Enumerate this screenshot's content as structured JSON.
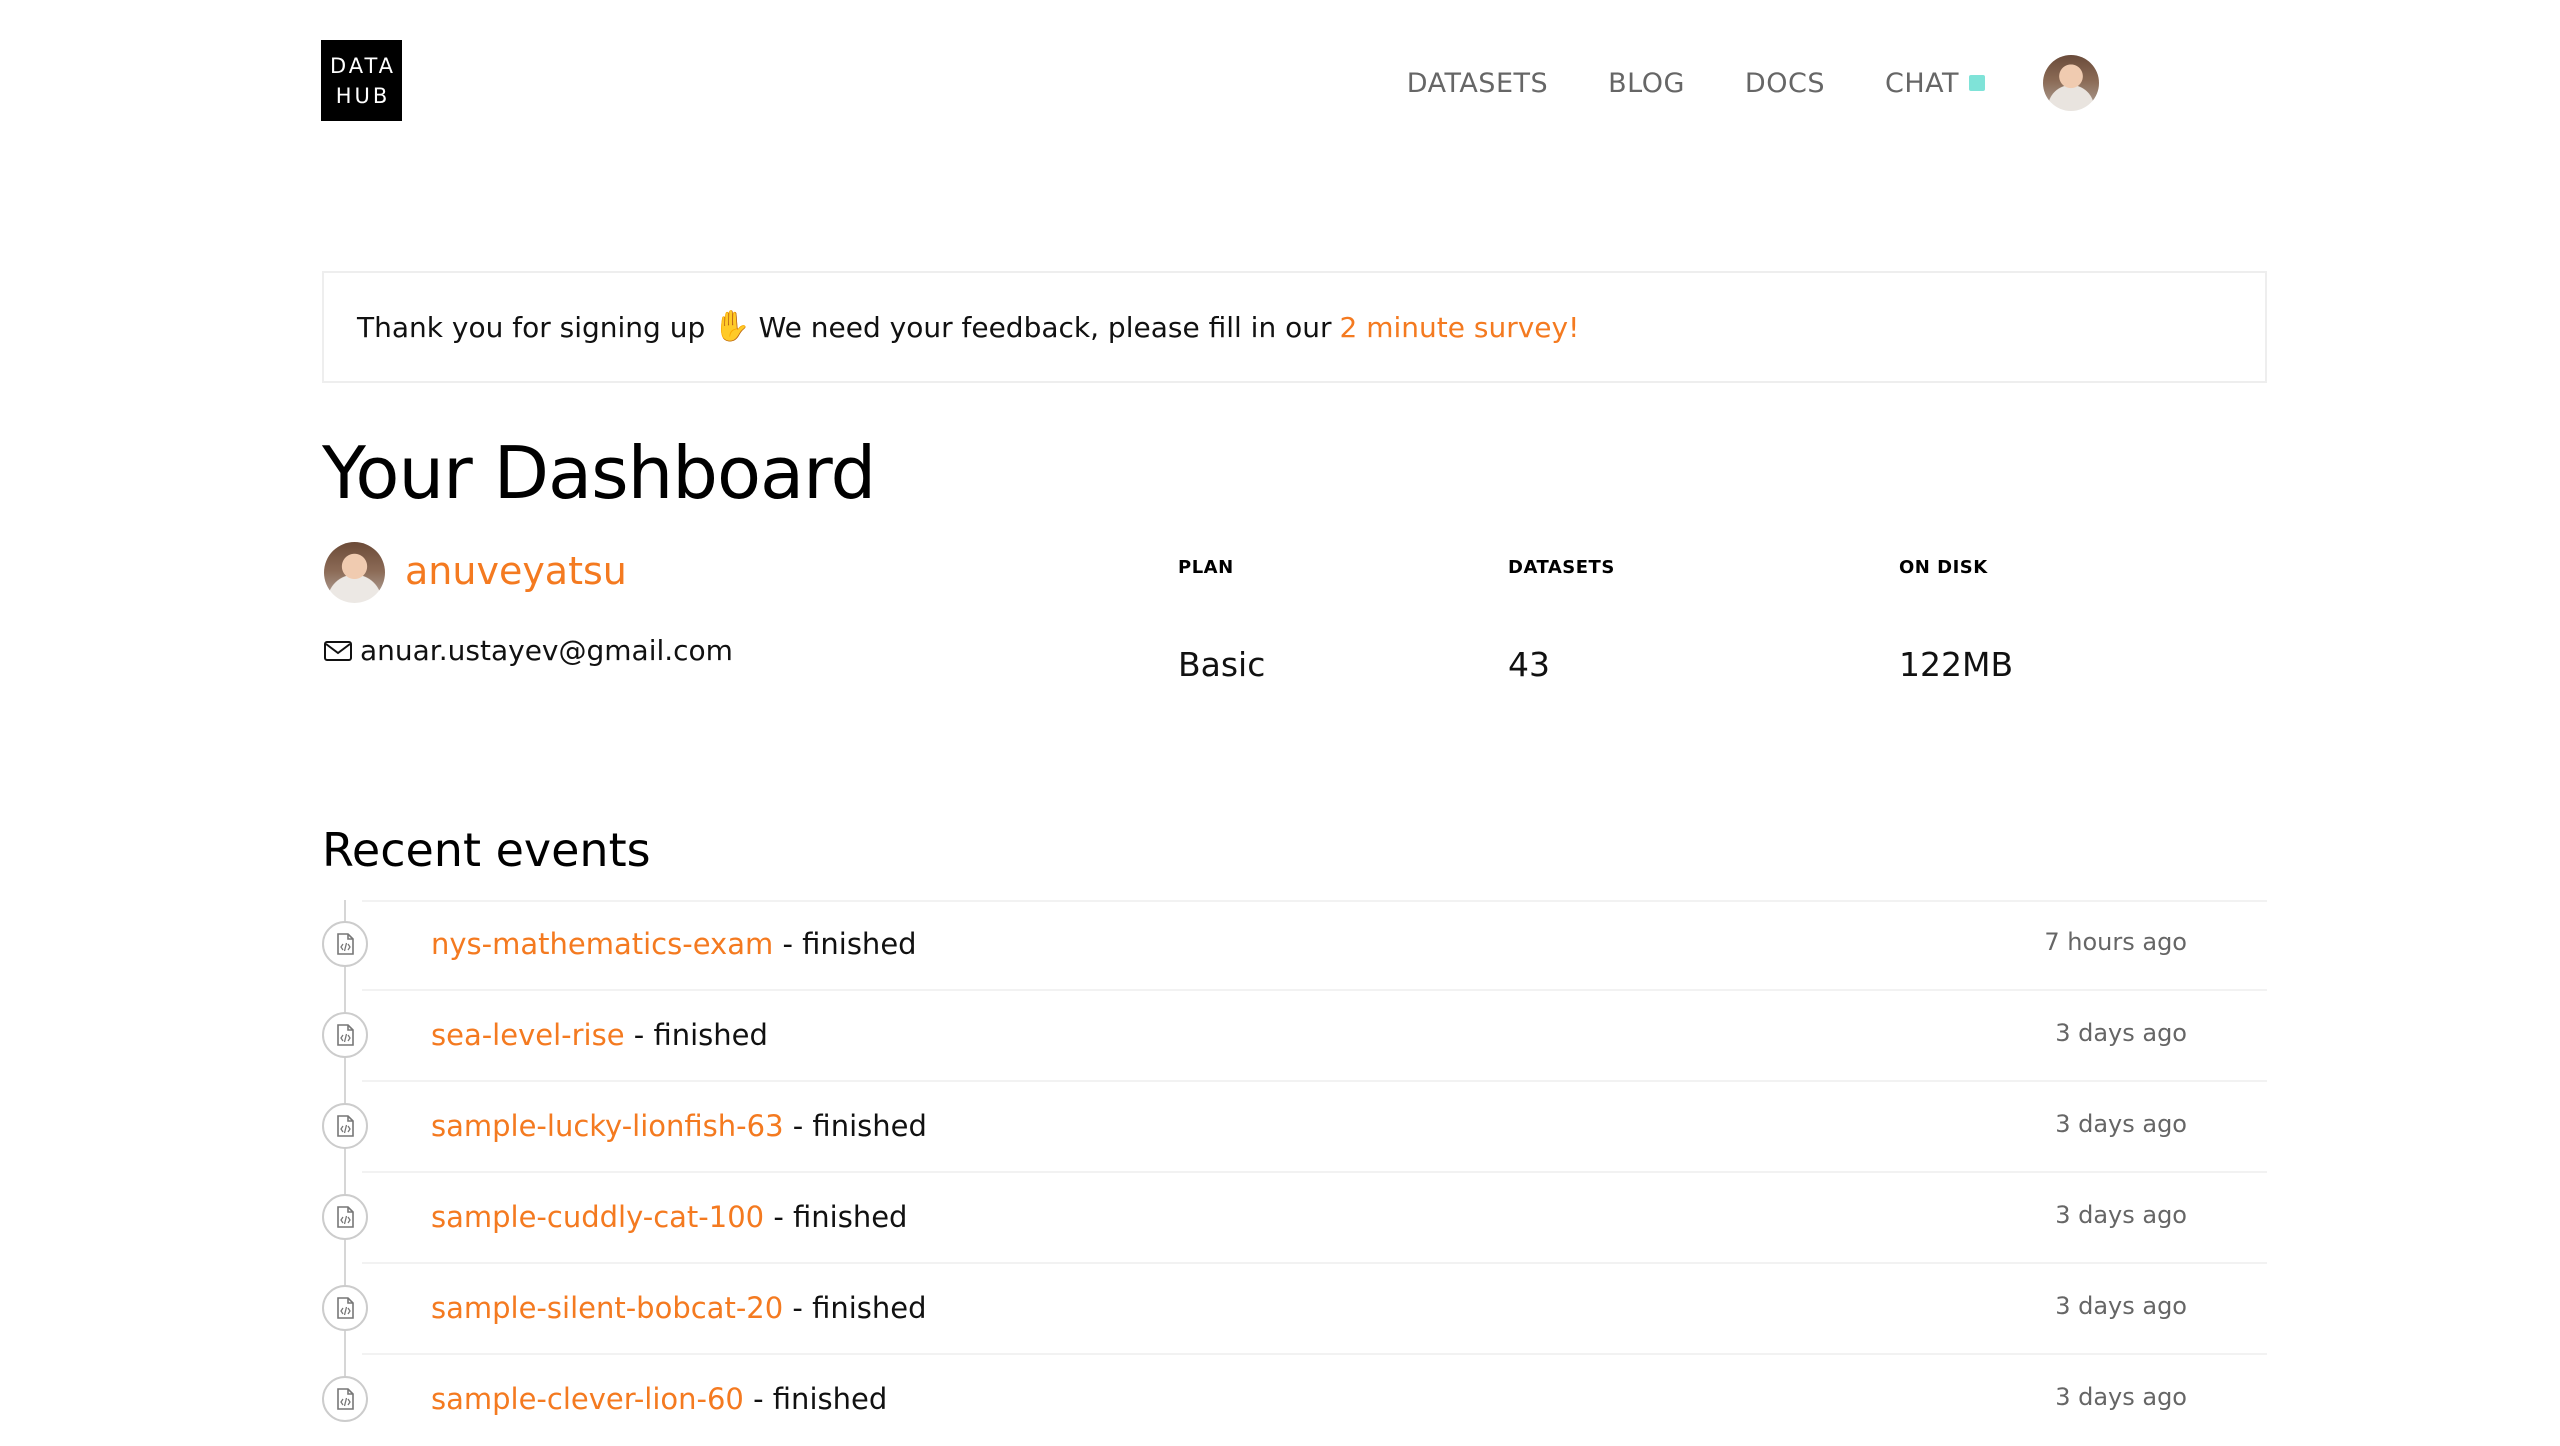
{
  "header": {
    "logo_line1": "DATA",
    "logo_line2": "HUB",
    "nav": {
      "datasets": "DATASETS",
      "blog": "BLOG",
      "docs": "DOCS",
      "chat": "CHAT"
    },
    "chat_status_color": "#7fe3d8"
  },
  "banner": {
    "text_before": "Thank you for signing up",
    "icon": "raised-hand-icon",
    "text_after": "We need your feedback, please fill in our",
    "link": "2 minute survey!"
  },
  "dashboard": {
    "title": "Your Dashboard",
    "username": "anuveyatsu",
    "email": "anuar.ustayev@gmail.com",
    "stats": {
      "plan_label": "PLAN",
      "plan_value": "Basic",
      "datasets_label": "DATASETS",
      "datasets_value": "43",
      "disk_label": "ON DISK",
      "disk_value": "122MB"
    }
  },
  "events": {
    "title": "Recent events",
    "items": [
      {
        "name": "nys-mathematics-exam",
        "status": "- finished",
        "time": "7 hours ago"
      },
      {
        "name": "sea-level-rise",
        "status": "- finished",
        "time": "3 days ago"
      },
      {
        "name": "sample-lucky-lionfish-63",
        "status": "- finished",
        "time": "3 days ago"
      },
      {
        "name": "sample-cuddly-cat-100",
        "status": "- finished",
        "time": "3 days ago"
      },
      {
        "name": "sample-silent-bobcat-20",
        "status": "- finished",
        "time": "3 days ago"
      },
      {
        "name": "sample-clever-lion-60",
        "status": "- finished",
        "time": "3 days ago"
      }
    ]
  },
  "colors": {
    "accent": "#f47a20",
    "muted": "#666666"
  }
}
